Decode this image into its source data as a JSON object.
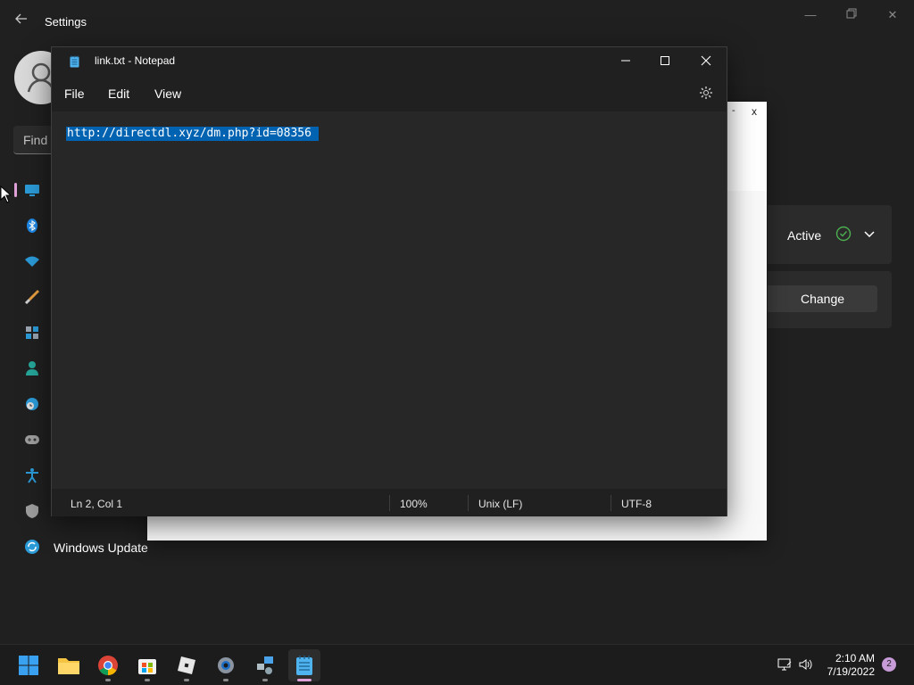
{
  "settings": {
    "title": "Settings",
    "search_placeholder": "Find",
    "nav_items": [
      {
        "icon": "monitor-icon",
        "label": ""
      },
      {
        "icon": "bluetooth-icon",
        "label": ""
      },
      {
        "icon": "wifi-icon",
        "label": ""
      },
      {
        "icon": "brush-icon",
        "label": ""
      },
      {
        "icon": "apps-icon",
        "label": ""
      },
      {
        "icon": "account-icon",
        "label": ""
      },
      {
        "icon": "clock-language-icon",
        "label": ""
      },
      {
        "icon": "gaming-icon",
        "label": ""
      },
      {
        "icon": "accessibility-icon",
        "label": ""
      },
      {
        "icon": "shield-icon",
        "label": ""
      },
      {
        "icon": "windows-update-icon",
        "label": "Windows Update"
      }
    ],
    "status_label": "Active",
    "change_button": "Change"
  },
  "dialog": {
    "min_label": "-",
    "close_label": "x"
  },
  "notepad": {
    "title": "link.txt - Notepad",
    "menu": {
      "file": "File",
      "edit": "Edit",
      "view": "View"
    },
    "content": "http://directdl.xyz/dm.php?id=08356",
    "status": {
      "position": "Ln 2, Col 1",
      "zoom": "100%",
      "line_ending": "Unix (LF)",
      "encoding": "UTF-8"
    }
  },
  "taskbar": {
    "apps": [
      "start-icon",
      "file-explorer-icon",
      "chrome-icon",
      "store-icon",
      "roblox-icon",
      "settings-icon",
      "network-app-icon",
      "notepad-icon"
    ],
    "time": "2:10 AM",
    "date": "7/19/2022",
    "notification_count": "2"
  },
  "colors": {
    "accent": "#0063b1",
    "nav_accent": "#e0a0d8",
    "check": "#4caf50"
  }
}
